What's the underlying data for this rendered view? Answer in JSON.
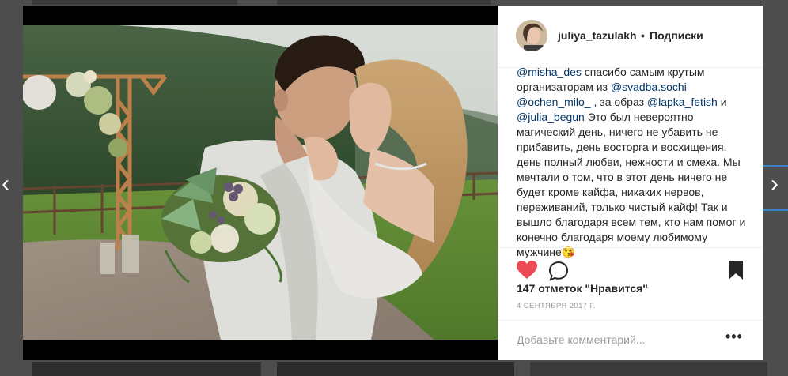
{
  "post": {
    "username": "juliya_tazulakh",
    "separator": "•",
    "follow_label": "Подписки",
    "caption": [
      {
        "type": "mention",
        "text": "@misha_des"
      },
      {
        "type": "text",
        "text": " спасибо самым крутым организаторам из "
      },
      {
        "type": "mention",
        "text": "@svadba.sochi"
      },
      {
        "type": "text",
        "text": " "
      },
      {
        "type": "mention",
        "text": "@ochen_milo_"
      },
      {
        "type": "text",
        "text": " , за образ "
      },
      {
        "type": "mention",
        "text": "@lapka_fetish"
      },
      {
        "type": "text",
        "text": " и "
      },
      {
        "type": "mention",
        "text": "@julia_begun"
      },
      {
        "type": "text",
        "text": " Это был невероятно магический день, ничего не убавить не прибавить, день восторга и восхищения, день полный любви, нежности и смеха. Мы мечтали о том, что в этот день ничего не будет кроме кайфа, никаких нервов, переживаний, только чистый кайф! Так и вышло благодаря всем тем, кто нам помог и конечно благодаря моему любимому мужчине😘"
      }
    ],
    "likes": "147 отметок \"Нравится\"",
    "date": "4 СЕНТЯБРЯ 2017 Г.",
    "comment_placeholder": "Добавьте комментарий...",
    "more_label": "•••"
  },
  "nav": {
    "prev_label": "‹",
    "next_label": "›"
  },
  "icons": {
    "like": "heart-icon",
    "comment": "comment-icon",
    "save": "bookmark-icon"
  },
  "colors": {
    "like_red": "#ed4956",
    "mention_blue": "#003569",
    "backdrop": "#4d4d4d"
  }
}
